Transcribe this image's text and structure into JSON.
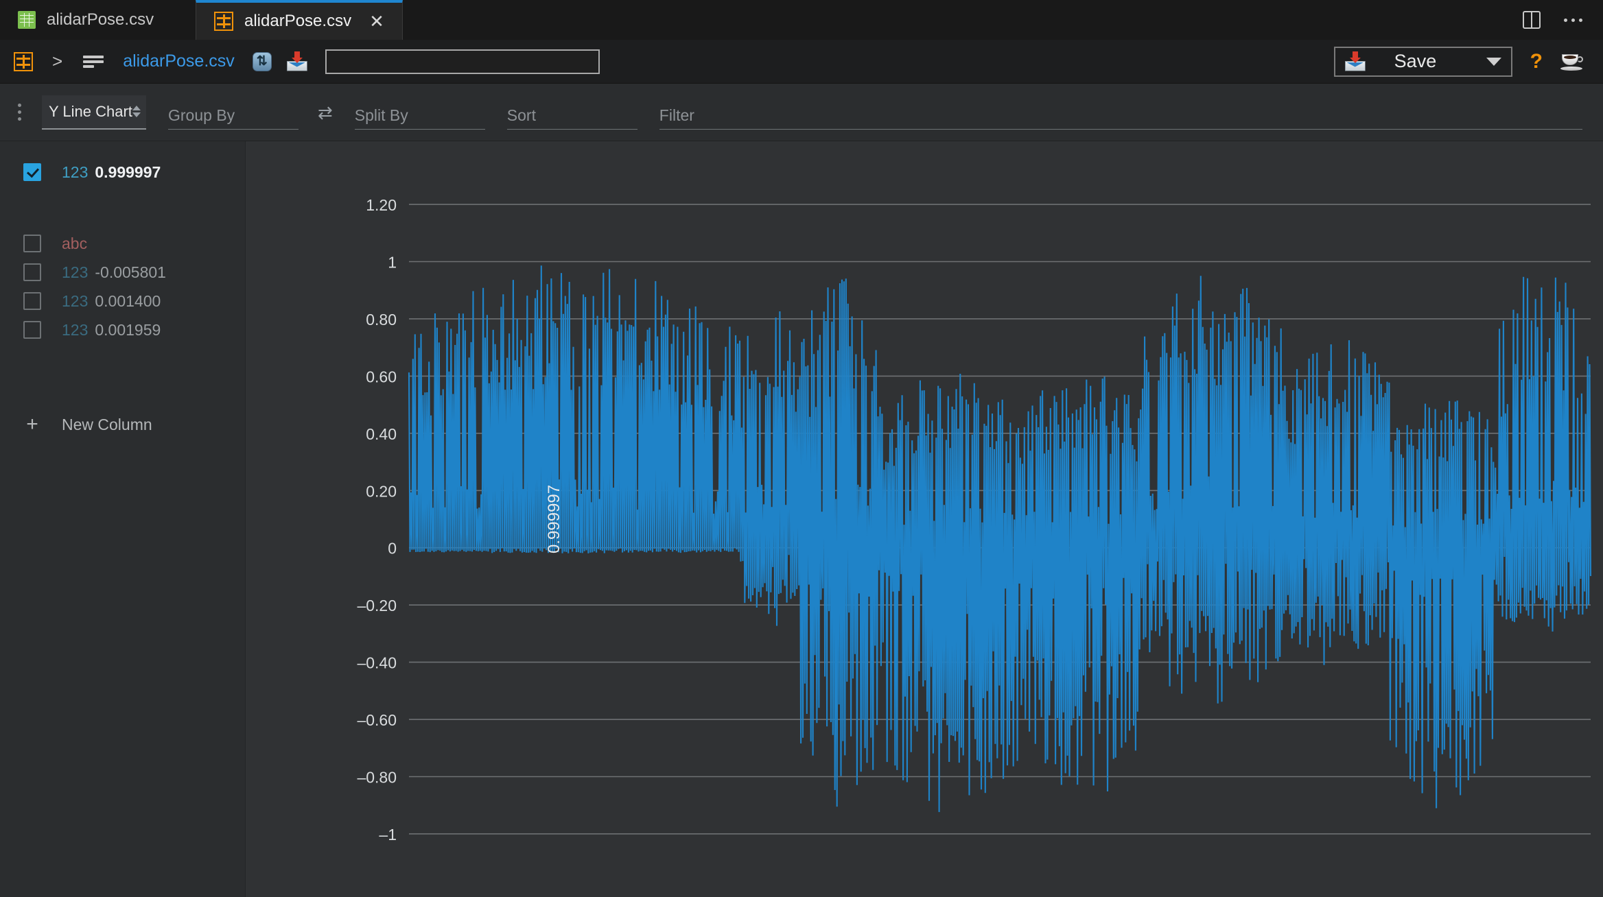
{
  "tabs": [
    {
      "label": "alidarPose.csv",
      "icon": "grid-icon",
      "active": false,
      "closable": false
    },
    {
      "label": "alidarPose.csv",
      "icon": "table-icon",
      "active": true,
      "closable": true,
      "close_label": "✕"
    }
  ],
  "window_controls": {
    "split_view_icon": "split-pane-icon",
    "more_icon": "ellipsis-icon"
  },
  "toolbar": {
    "app_icon": "table-icon",
    "breadcrumb_separator": ">",
    "rows_icon": "rows-icon",
    "filename": "alidarPose.csv",
    "sync_icon": "sync-icon",
    "sync_glyph": "⇅",
    "import_icon": "inbox-import-icon",
    "search_value": "",
    "search_placeholder": "",
    "save_label": "Save",
    "save_icon": "inbox-save-icon",
    "dropdown_icon": "chevron-down-icon",
    "help_label": "?",
    "coffee_icon": "coffee-cup-icon"
  },
  "controls": {
    "menu_icon": "vertical-dots-icon",
    "chart_type": "Y Line Chart",
    "chart_type_icon": "spinner-arrows-icon",
    "group_by_placeholder": "Group By",
    "swap_icon": "swap-arrows-icon",
    "swap_glyph": "⇄",
    "split_by_placeholder": "Split By",
    "sort_placeholder": "Sort",
    "filter_placeholder": "Filter"
  },
  "sidebar": {
    "columns": [
      {
        "checked": true,
        "type": "123",
        "type_kind": "number",
        "value": "0.999997",
        "selected": true
      },
      {
        "checked": false,
        "type": "abc",
        "type_kind": "text",
        "value": "",
        "selected": false
      },
      {
        "checked": false,
        "type": "123",
        "type_kind": "number",
        "value": "-0.005801",
        "selected": false
      },
      {
        "checked": false,
        "type": "123",
        "type_kind": "number",
        "value": "0.001400",
        "selected": false
      },
      {
        "checked": false,
        "type": "123",
        "type_kind": "number",
        "value": "0.001959",
        "selected": false
      }
    ],
    "new_column_label": "New Column",
    "new_column_icon": "plus-icon"
  },
  "colors": {
    "line": "#1f83c8",
    "accent_blue": "#3c9ae8",
    "checkbox_checked": "#29a3e0",
    "orange": "#f0920a",
    "plot_bg": "#303234",
    "grid": "#6e7173"
  },
  "chart_data": {
    "type": "line",
    "title": "",
    "xlabel": "",
    "ylabel": "0.999997",
    "ylim": [
      -1.12,
      1.32
    ],
    "yticks": [
      1.2,
      1,
      0.8,
      0.6,
      0.4,
      0.2,
      0,
      -0.2,
      -0.4,
      -0.6,
      -0.8,
      -1
    ],
    "ytick_labels": [
      "1.20",
      "1",
      "0.80",
      "0.60",
      "0.40",
      "0.20",
      "0",
      "–0.20",
      "–0.40",
      "–0.60",
      "–0.80",
      "–1"
    ],
    "grid": true,
    "legend": "none",
    "series": [
      {
        "name": "0.999997",
        "color": "#1f83c8",
        "description": "Dense high-frequency oscillating quaternion-like signal spanning roughly -1 to 1 over ~1200 samples",
        "segments": [
          {
            "start_frac": 0.0,
            "end_frac": 0.28,
            "high": 1.0,
            "low": -0.02,
            "note": "full-scale spikes from 0 up to 1, baseline near 0"
          },
          {
            "start_frac": 0.28,
            "end_frac": 0.33,
            "high": 0.92,
            "low": -0.28,
            "note": "amplitude broadening downward"
          },
          {
            "start_frac": 0.33,
            "end_frac": 0.4,
            "high": 0.95,
            "low": -0.95,
            "note": "full swing both directions"
          },
          {
            "start_frac": 0.4,
            "end_frac": 0.52,
            "high": 0.62,
            "low": -0.96,
            "note": "mostly negative large excursions"
          },
          {
            "start_frac": 0.52,
            "end_frac": 0.62,
            "high": 0.63,
            "low": -0.9,
            "note": "mixed medium amplitude"
          },
          {
            "start_frac": 0.62,
            "end_frac": 0.74,
            "high": 1.0,
            "low": -0.55,
            "note": "rising hump peaking near 1"
          },
          {
            "start_frac": 0.74,
            "end_frac": 0.83,
            "high": 0.75,
            "low": -0.42,
            "note": "dense cluster around 0.1-0.2"
          },
          {
            "start_frac": 0.83,
            "end_frac": 0.92,
            "high": 0.55,
            "low": -0.92,
            "note": "deep negative block"
          },
          {
            "start_frac": 0.92,
            "end_frac": 1.0,
            "high": 1.0,
            "low": -0.3,
            "note": "final rise to near 1"
          }
        ]
      }
    ]
  }
}
